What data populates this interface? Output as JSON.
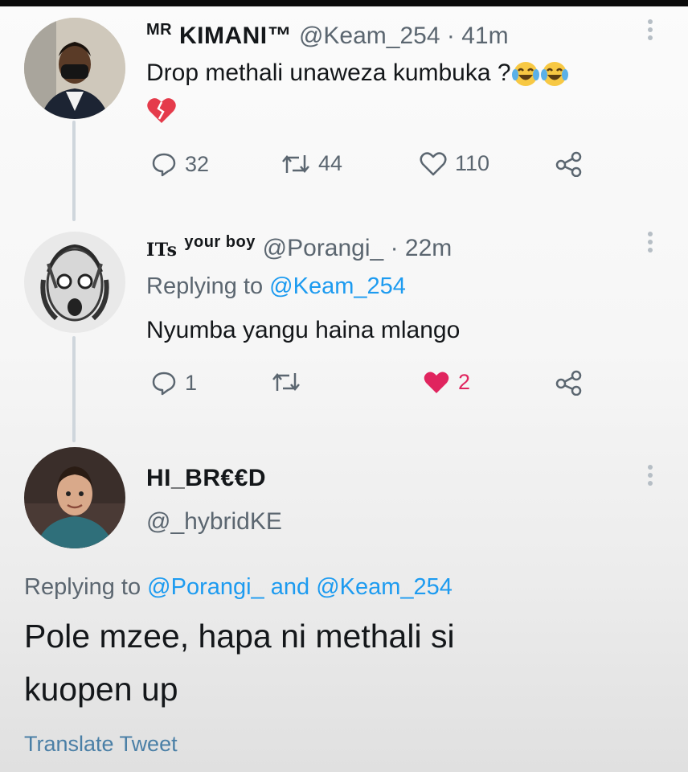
{
  "tweet1": {
    "name_prefix": "MR",
    "name": "KIMANI™",
    "handle": "@Keam_254",
    "dot": "·",
    "time": "41m",
    "text": "Drop methali unaweza kumbuka ?",
    "emojis": [
      "face-with-tears-of-joy",
      "face-with-tears-of-joy",
      "broken-heart"
    ],
    "replies": "32",
    "retweets": "44",
    "likes": "110"
  },
  "tweet2": {
    "name_prefix": "ITs",
    "name": "your boy",
    "handle": "@Porangi_",
    "dot": "·",
    "time": "22m",
    "replying_to_label": "Replying to",
    "replying_to": "@Keam_254",
    "text": "Nyumba yangu haina mlango",
    "replies": "1",
    "retweets": "",
    "likes": "2",
    "liked_color": "#e0245e"
  },
  "tweet3": {
    "name": "HI_BR€€D",
    "handle": "@_hybridKE",
    "replying_to_label": "Replying to",
    "replying_to_1": "@Porangi_",
    "and_label": "and",
    "replying_to_2": "@Keam_254",
    "text_line1": "Pole mzee, hapa ni methali si",
    "text_line2": "kuopen up",
    "translate": "Translate Tweet"
  },
  "colors": {
    "accent": "#1d9bf0",
    "muted_text": "#5b6670",
    "like": "#e0245e"
  }
}
